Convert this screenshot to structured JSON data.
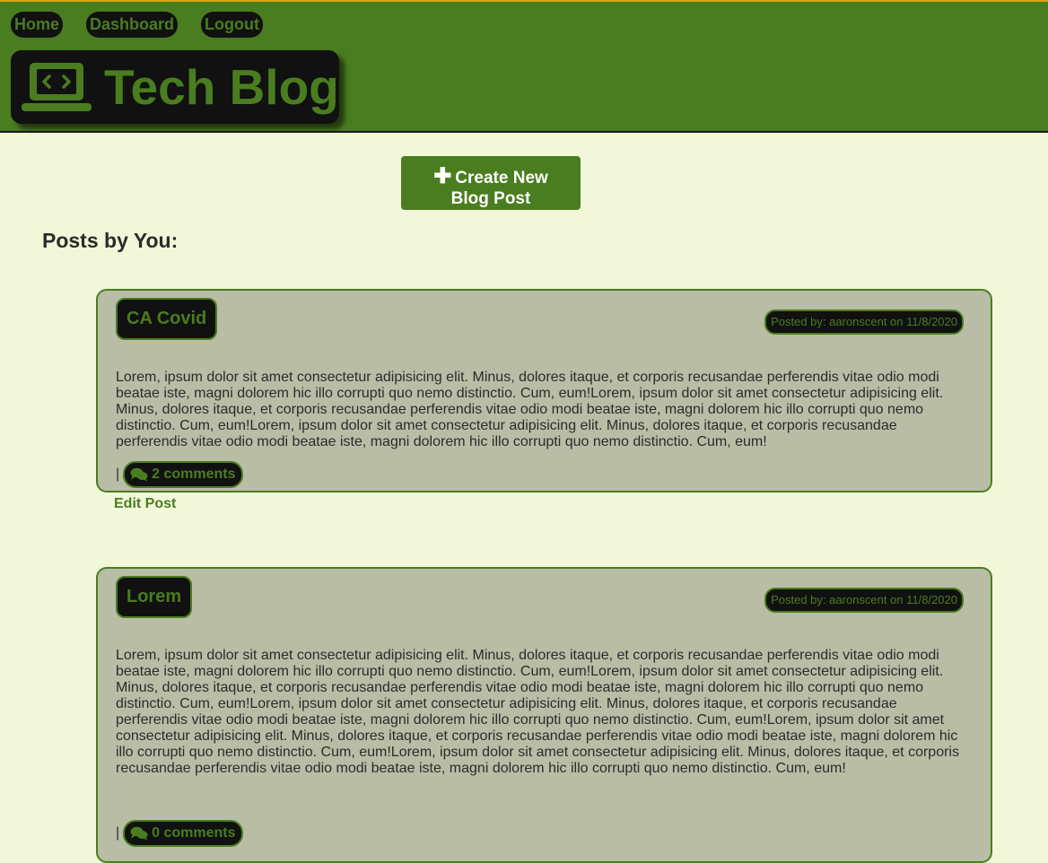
{
  "nav": {
    "home": "Home",
    "dashboard": "Dashboard",
    "logout": "Logout"
  },
  "logo": {
    "title": "Tech Blog",
    "icon": "laptop-code-icon"
  },
  "create_button": {
    "icon": "plus-icon",
    "line1": "Create New",
    "line2": "Blog Post"
  },
  "section_title": "Posts by You:",
  "posts": [
    {
      "title": "CA Covid",
      "posted_by": "Posted by: aaronscent on 11/8/2020",
      "body": "Lorem, ipsum dolor sit amet consectetur adipisicing elit. Minus, dolores itaque, et corporis recusandae perferendis vitae odio modi beatae iste, magni dolorem hic illo corrupti quo nemo distinctio. Cum, eum!Lorem, ipsum dolor sit amet consectetur adipisicing elit. Minus, dolores itaque, et corporis recusandae perferendis vitae odio modi beatae iste, magni dolorem hic illo corrupti quo nemo distinctio. Cum, eum!Lorem, ipsum dolor sit amet consectetur adipisicing elit. Minus, dolores itaque, et corporis recusandae perferendis vitae odio modi beatae iste, magni dolorem hic illo corrupti quo nemo distinctio. Cum, eum!",
      "separator": "|",
      "comments": "2 comments",
      "edit": "Edit Post"
    },
    {
      "title": "Lorem",
      "posted_by": "Posted by: aaronscent on 11/8/2020",
      "body": "Lorem, ipsum dolor sit amet consectetur adipisicing elit. Minus, dolores itaque, et corporis recusandae perferendis vitae odio modi beatae iste, magni dolorem hic illo corrupti quo nemo distinctio. Cum, eum!Lorem, ipsum dolor sit amet consectetur adipisicing elit. Minus, dolores itaque, et corporis recusandae perferendis vitae odio modi beatae iste, magni dolorem hic illo corrupti quo nemo distinctio. Cum, eum!Lorem, ipsum dolor sit amet consectetur adipisicing elit. Minus, dolores itaque, et corporis recusandae perferendis vitae odio modi beatae iste, magni dolorem hic illo corrupti quo nemo distinctio. Cum, eum!Lorem, ipsum dolor sit amet consectetur adipisicing elit. Minus, dolores itaque, et corporis recusandae perferendis vitae odio modi beatae iste, magni dolorem hic illo corrupti quo nemo distinctio. Cum, eum!Lorem, ipsum dolor sit amet consectetur adipisicing elit. Minus, dolores itaque, et corporis recusandae perferendis vitae odio modi beatae iste, magni dolorem hic illo corrupti quo nemo distinctio. Cum, eum!",
      "separator": "|",
      "comments": "0 comments"
    }
  ],
  "colors": {
    "header_bg": "#4a7d1f",
    "accent": "#4a7d1f",
    "page_bg": "#f2f7da",
    "card_bg": "#b9bda6",
    "dark": "#111111"
  },
  "icons": {
    "comments": "comments-icon"
  }
}
